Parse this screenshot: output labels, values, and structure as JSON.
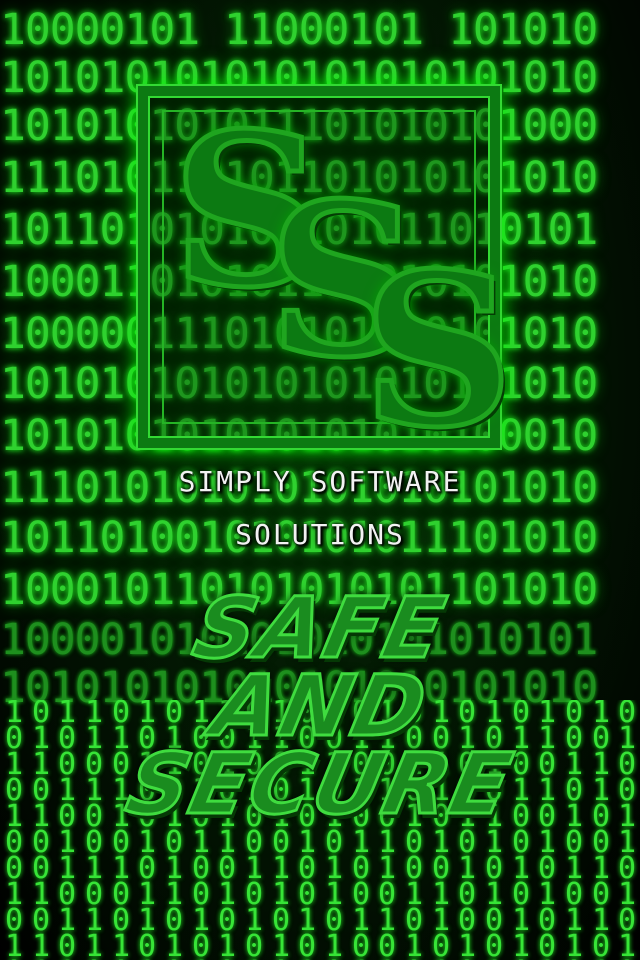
{
  "background": {
    "rows": [
      "10000101 11000101 101010",
      "101010101010101010101010",
      "101010101011101010101000",
      "111010110101101010101010",
      "101101010101101011010101",
      "100011010101101010101010",
      "100000111010101010101010",
      "101010101010101010101010",
      "101010101010101010100010",
      "111010101010101010101010",
      "101101001010101011101010",
      "100010110101010101101010",
      "100001010101010101010101",
      "101010101010101010101010"
    ],
    "columns": [
      "1010100101011010",
      "0110100101101011",
      "1001011010100101",
      "1101001011010010",
      "0101101001011010",
      "1010010110100101",
      "0110101101001011",
      "1001010010110110",
      "1010110101001010",
      "0101001010110101",
      "1100101101010010",
      "0011010010101101",
      "1010101101010010",
      "0101010010101101",
      "1101011010100101",
      "0010100101011010",
      "1011010110100101",
      "0100101001011010",
      "1010110100101101",
      "0101001011010010",
      "1101010100101011",
      "0010101011010100",
      "1011001010110101",
      "0100110101001010"
    ],
    "color": "#2fd12f"
  },
  "logo": {
    "letters": [
      "S",
      "S",
      "S"
    ],
    "border_color": "#0c7a12",
    "glow_color": "#33d933"
  },
  "company": {
    "line1": "SIMPLY SOFTWARE",
    "line2": "SOLUTIONS"
  },
  "tagline": {
    "line1": "SAFE",
    "line2": "AND",
    "line3": "SECURE",
    "color": "#1a8c1f"
  }
}
